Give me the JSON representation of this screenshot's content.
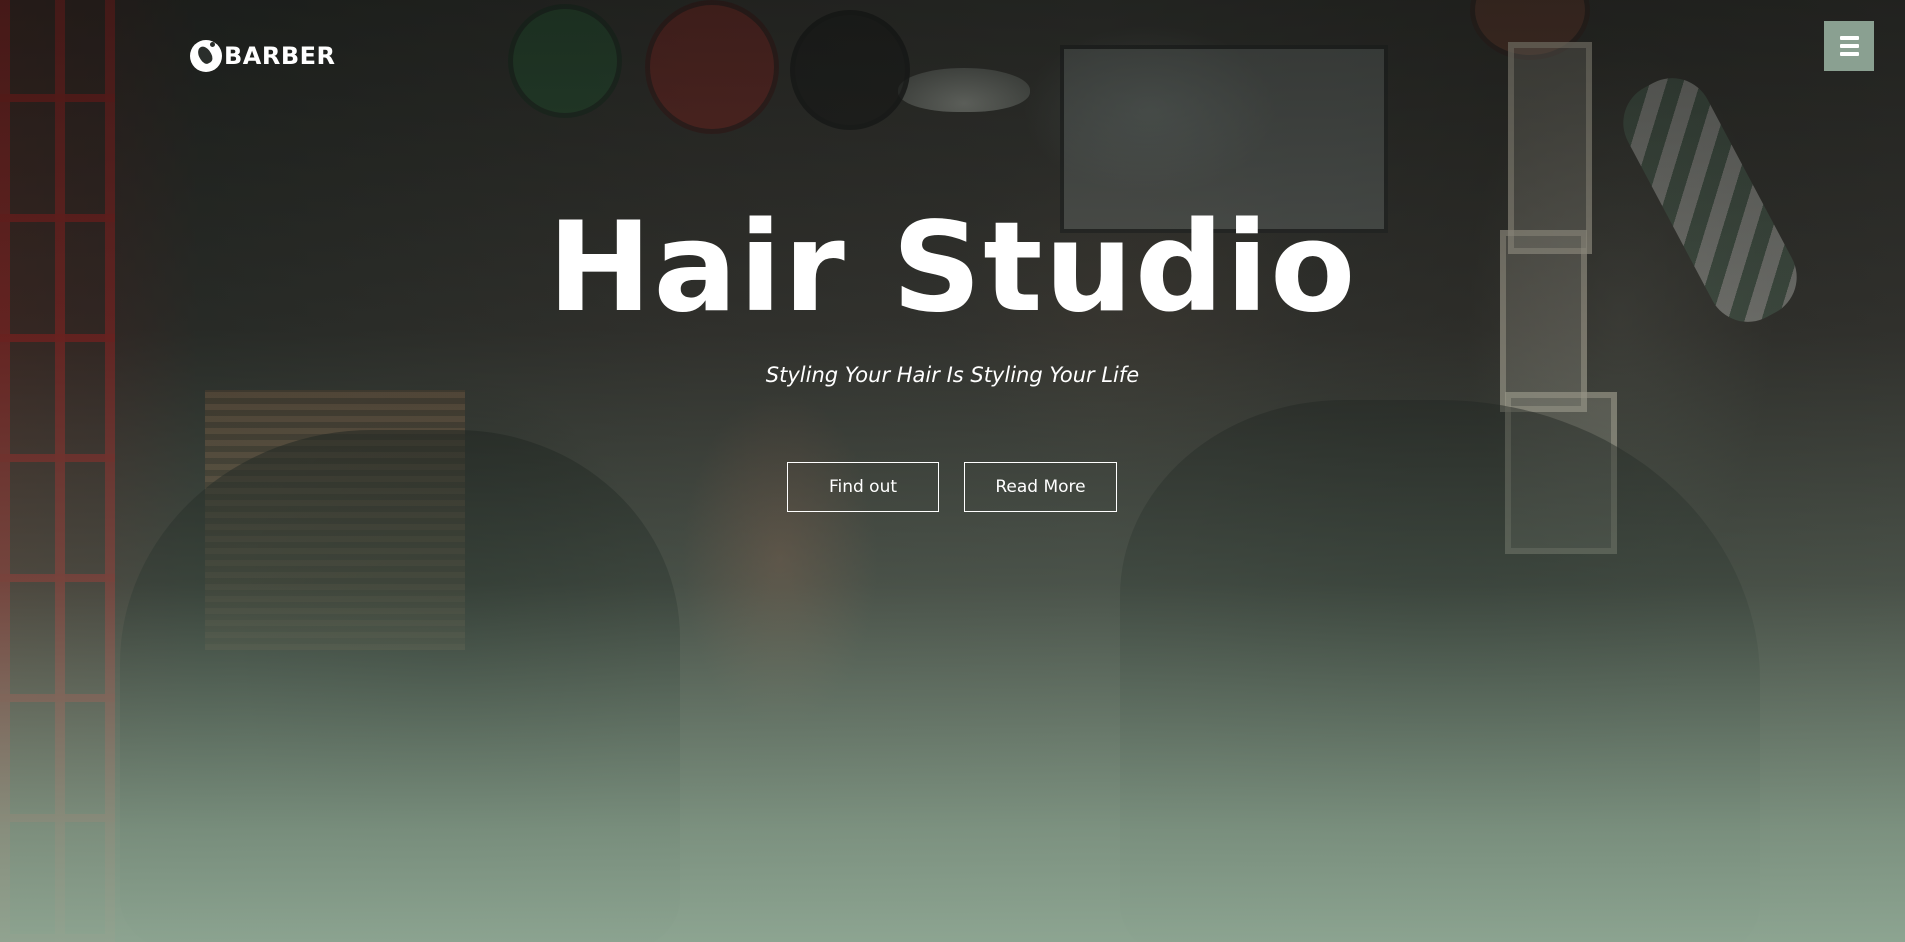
{
  "header": {
    "logo_text": "BARBER",
    "logo_icon": "barber-head-icon",
    "menu_icon": "hamburger-icon"
  },
  "hero": {
    "title": "Hair Studio",
    "subtitle": "Styling Your Hair Is Styling Your Life",
    "buttons": {
      "find_out": "Find out",
      "read_more": "Read More"
    }
  },
  "colors": {
    "menu_button_bg": "#8aa091",
    "overlay_tint": "#91aa96",
    "text": "#ffffff"
  }
}
